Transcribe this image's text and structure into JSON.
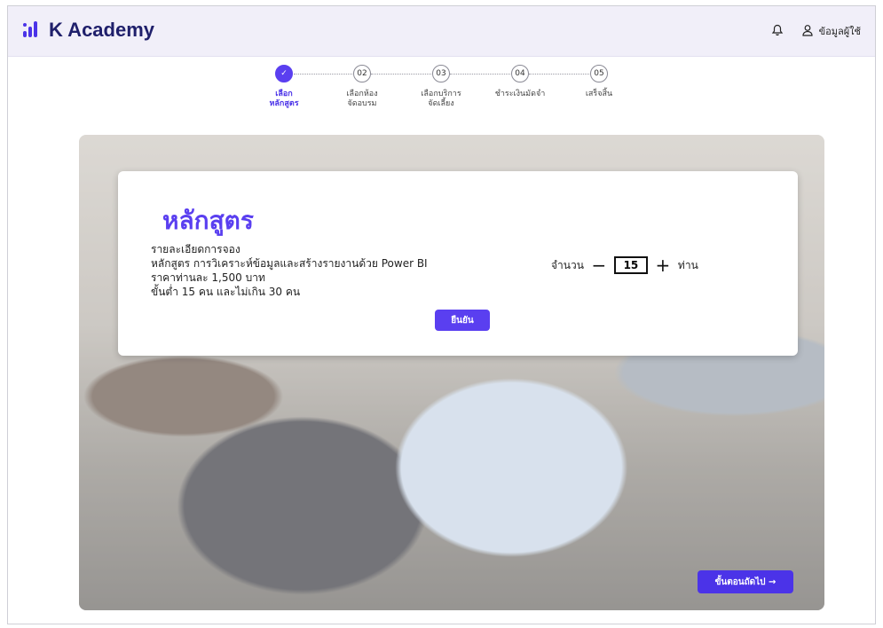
{
  "app": {
    "title": "K Academy"
  },
  "header": {
    "user_label": "ข้อมูลผู้ใช้"
  },
  "stepper": {
    "steps": [
      {
        "num": "✓",
        "label_line1": "เลือก",
        "label_line2": "หลักสูตร"
      },
      {
        "num": "02",
        "label_line1": "เลือกห้อง",
        "label_line2": "จัดอบรม"
      },
      {
        "num": "03",
        "label_line1": "เลือกบริการ",
        "label_line2": "จัดเลี้ยง"
      },
      {
        "num": "04",
        "label_line1": "ชำระเงินมัดจำ",
        "label_line2": ""
      },
      {
        "num": "05",
        "label_line1": "เสร็จสิ้น",
        "label_line2": ""
      }
    ]
  },
  "card": {
    "title": "หลักสูตร",
    "details": [
      "รายละเอียดการจอง",
      "หลักสูตร การวิเคราะห์ข้อมูลและสร้างรายงานด้วย Power BI",
      "ราคาท่านละ 1,500 บาท",
      "ขั้นต่ำ 15 คน และไม่เกิน 30 คน"
    ],
    "confirm_label": "ยืนยัน",
    "quantity": {
      "label": "จำนวน",
      "minus": "−",
      "value": "15",
      "plus": "+",
      "unit": "ท่าน"
    }
  },
  "next_button": {
    "label": "ขั้นตอนถัดไป →"
  },
  "colors": {
    "accent": "#5a3ff0",
    "header_bg": "#f1eff9"
  }
}
